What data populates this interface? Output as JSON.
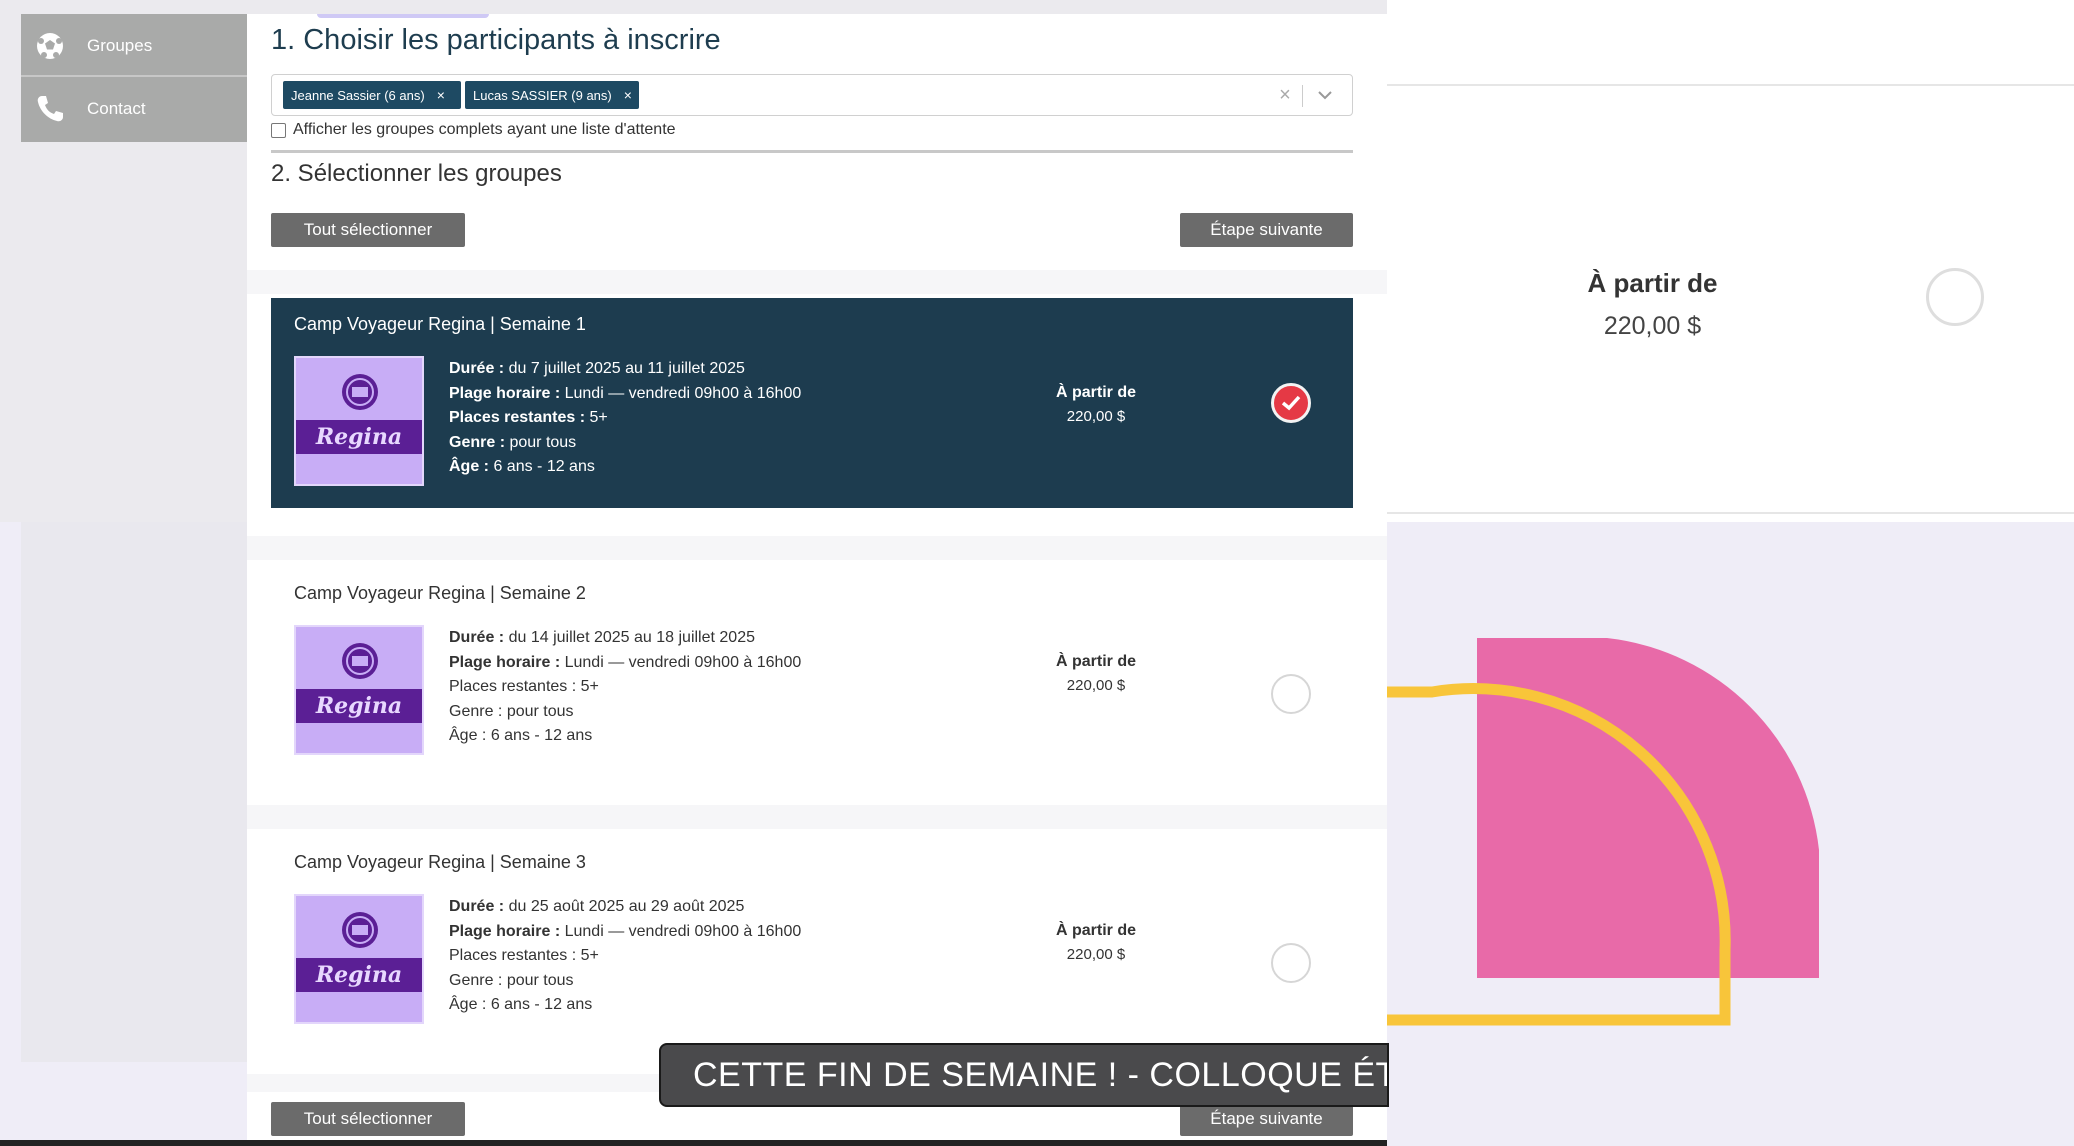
{
  "sidebar": {
    "items": [
      {
        "label": "Groupes",
        "icon": "soccer-ball-icon"
      },
      {
        "label": "Contact",
        "icon": "phone-icon"
      }
    ]
  },
  "main": {
    "step1_title": "1. Choisir les participants à inscrire",
    "participants": [
      {
        "label": "Jeanne Sassier (6 ans)",
        "remove": "×"
      },
      {
        "label": "Lucas SASSIER (9 ans)",
        "remove": "×"
      }
    ],
    "clear_label": "×",
    "waitlist_checkbox": {
      "label": "Afficher les groupes complets ayant une liste d'attente",
      "checked": false
    },
    "step2_title": "2. Sélectionner les groupes",
    "select_all_label": "Tout sélectionner",
    "next_step_label": "Étape suivante",
    "groups": [
      {
        "title": "Camp Voyageur Regina | Semaine 1",
        "image_text": "Regina",
        "duree_label": "Durée :",
        "duree": "du 7 juillet 2025 au 11 juillet 2025",
        "plage_label": "Plage horaire :",
        "plage": "Lundi — vendredi 09h00 à 16h00",
        "places_label": "Places restantes :",
        "places": "5+",
        "genre_label": "Genre :",
        "genre": "pour tous",
        "age_label": "Âge :",
        "age": "6 ans - 12 ans",
        "price_label": "À partir de",
        "price": "220,00 $",
        "selected": true
      },
      {
        "title": "Camp Voyageur Regina | Semaine 2",
        "image_text": "Regina",
        "duree_label": "Durée :",
        "duree": "du 14 juillet 2025 au 18 juillet 2025",
        "plage_label": "Plage horaire :",
        "plage": "Lundi — vendredi 09h00 à 16h00",
        "places_label": "Places restantes :",
        "places": "5+",
        "genre_label": "Genre :",
        "genre": "pour tous",
        "age_label": "Âge :",
        "age": "6 ans - 12 ans",
        "price_label": "À partir de",
        "price": "220,00 $",
        "selected": false
      },
      {
        "title": "Camp Voyageur Regina | Semaine 3",
        "image_text": "Regina",
        "duree_label": "Durée :",
        "duree": "du 25 août 2025 au 29 août 2025",
        "plage_label": "Plage horaire :",
        "plage": "Lundi — vendredi 09h00 à 16h00",
        "places_label": "Places restantes :",
        "places": "5+",
        "genre_label": "Genre :",
        "genre": "pour tous",
        "age_label": "Âge :",
        "age": "6 ans - 12 ans",
        "price_label": "À partir de",
        "price": "220,00 $",
        "selected": false
      }
    ]
  },
  "right_panel": {
    "price_label": "À partir de",
    "price": "220,00 $"
  },
  "ticker": {
    "text": "CETTE FIN DE SEMAINE ! - COLLOQUE ÉTUD."
  },
  "colors": {
    "selected_card": "#1d3c4f",
    "check": "#e53945",
    "chip": "#1e4a63",
    "deco_pink": "#e86aa8",
    "deco_yellow": "#f8c53a"
  }
}
